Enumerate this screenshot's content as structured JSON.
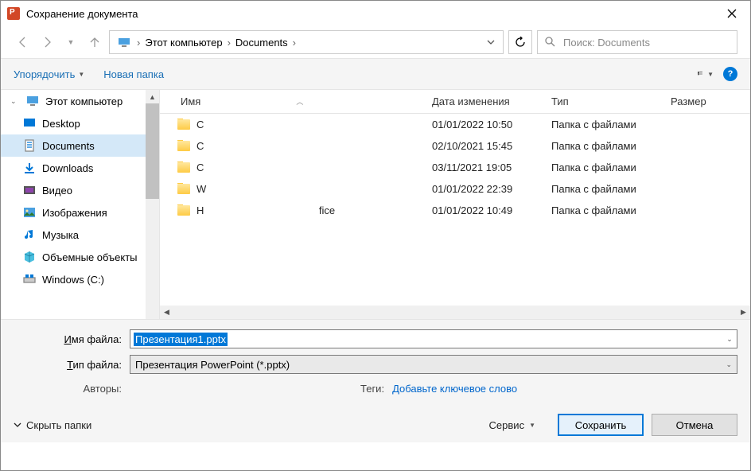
{
  "window": {
    "title": "Сохранение документа"
  },
  "breadcrumb": {
    "seg1": "Этот компьютер",
    "seg2": "Documents"
  },
  "search": {
    "placeholder": "Поиск: Documents"
  },
  "toolbar": {
    "organize": "Упорядочить",
    "new_folder": "Новая папка"
  },
  "sidebar": {
    "items": [
      {
        "label": "Этот компьютер",
        "icon": "pc"
      },
      {
        "label": "Desktop",
        "icon": "desktop"
      },
      {
        "label": "Documents",
        "icon": "documents"
      },
      {
        "label": "Downloads",
        "icon": "downloads"
      },
      {
        "label": "Видео",
        "icon": "video"
      },
      {
        "label": "Изображения",
        "icon": "pictures"
      },
      {
        "label": "Музыка",
        "icon": "music"
      },
      {
        "label": "Объемные объекты",
        "icon": "3d"
      },
      {
        "label": "Windows (C:)",
        "icon": "drive"
      }
    ]
  },
  "columns": {
    "name": "Имя",
    "date": "Дата изменения",
    "type": "Тип",
    "size": "Размер"
  },
  "files": [
    {
      "name": "C",
      "date": "01/01/2022 10:50",
      "type": "Папка с файлами"
    },
    {
      "name": "C",
      "date": "02/10/2021 15:45",
      "type": "Папка с файлами"
    },
    {
      "name": "C",
      "date": "03/11/2021 19:05",
      "type": "Папка с файлами"
    },
    {
      "name": "W",
      "date": "01/01/2022 22:39",
      "type": "Папка с файлами"
    },
    {
      "name": "Н                                        fice",
      "date": "01/01/2022 10:49",
      "type": "Папка с файлами"
    }
  ],
  "fields": {
    "filename_label_u": "И",
    "filename_label_rest": "мя файла:",
    "filetype_label_u": "Т",
    "filetype_label_rest": "ип файла:",
    "filename_value": "Презентация1.pptx",
    "filetype_value": "Презентация PowerPoint (*.pptx)",
    "authors_label": "Авторы:",
    "tags_label": "Теги:",
    "tags_value": "Добавьте ключевое слово"
  },
  "actions": {
    "hide_folders": "Скрыть папки",
    "tools": "Сервис",
    "save_u": "С",
    "save_rest": "охранить",
    "cancel": "Отмена"
  }
}
